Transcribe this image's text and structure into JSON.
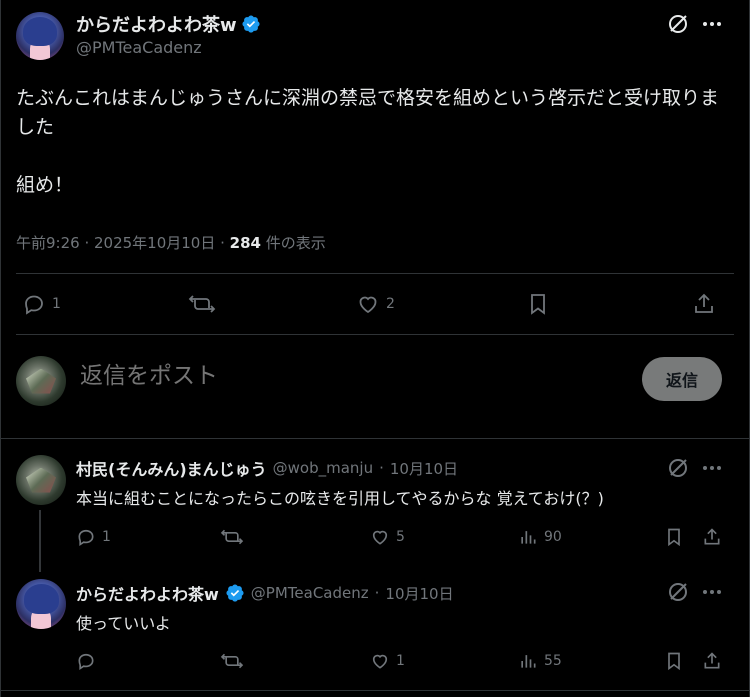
{
  "main_tweet": {
    "display_name": "からだよわよわ茶w",
    "handle": "@PMTeaCadenz",
    "text": "たぶんこれはまんじゅうさんに深淵の禁忌で格安を組めという啓示だと受け取りました\n\n組め！",
    "time": "午前9:26",
    "date": "2025年10月10日",
    "views_count": "284",
    "views_label": "件の表示",
    "replies": "1",
    "likes": "2"
  },
  "composer": {
    "placeholder": "返信をポスト",
    "button_label": "返信"
  },
  "replies": [
    {
      "display_name": "村民(そんみん)まんじゅう",
      "handle": "@wob_manju",
      "date": "10月10日",
      "text": "本当に組むことになったらこの呟きを引用してやるからな 覚えておけ(？)",
      "replies": "1",
      "retweets": "",
      "likes": "5",
      "views": "90"
    },
    {
      "display_name": "からだよわよわ茶w",
      "handle": "@PMTeaCadenz",
      "date": "10月10日",
      "text": "使っていいよ",
      "replies": "",
      "retweets": "",
      "likes": "1",
      "views": "55"
    }
  ],
  "colors": {
    "background": "#000000",
    "text": "#e7e9ea",
    "muted": "#71767b",
    "verified": "#1d9bf0",
    "divider": "#2f3336"
  }
}
